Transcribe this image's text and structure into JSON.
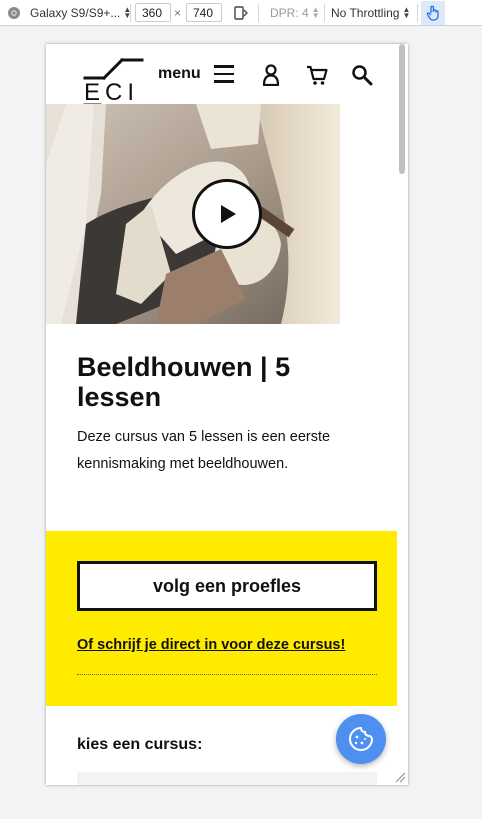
{
  "devtools": {
    "device_name": "Galaxy S9/S9+...",
    "width": "360",
    "times": "×",
    "height": "740",
    "dpr": "DPR: 4",
    "throttling": "No Throttling"
  },
  "header": {
    "menu_label": "menu"
  },
  "course": {
    "title": "Beeldhouwen | 5 lessen",
    "description": "Deze cursus van 5 lessen is een eerste kennismaking met beeldhouwen."
  },
  "cta": {
    "trial_button": "volg een proefles",
    "enroll_link": "Of schrijf je direct in voor deze cursus!"
  },
  "choose_course": {
    "label": "kies een cursus:"
  },
  "colors": {
    "accent_yellow": "#ffeb00",
    "cookie_blue": "#4f8ff0"
  }
}
